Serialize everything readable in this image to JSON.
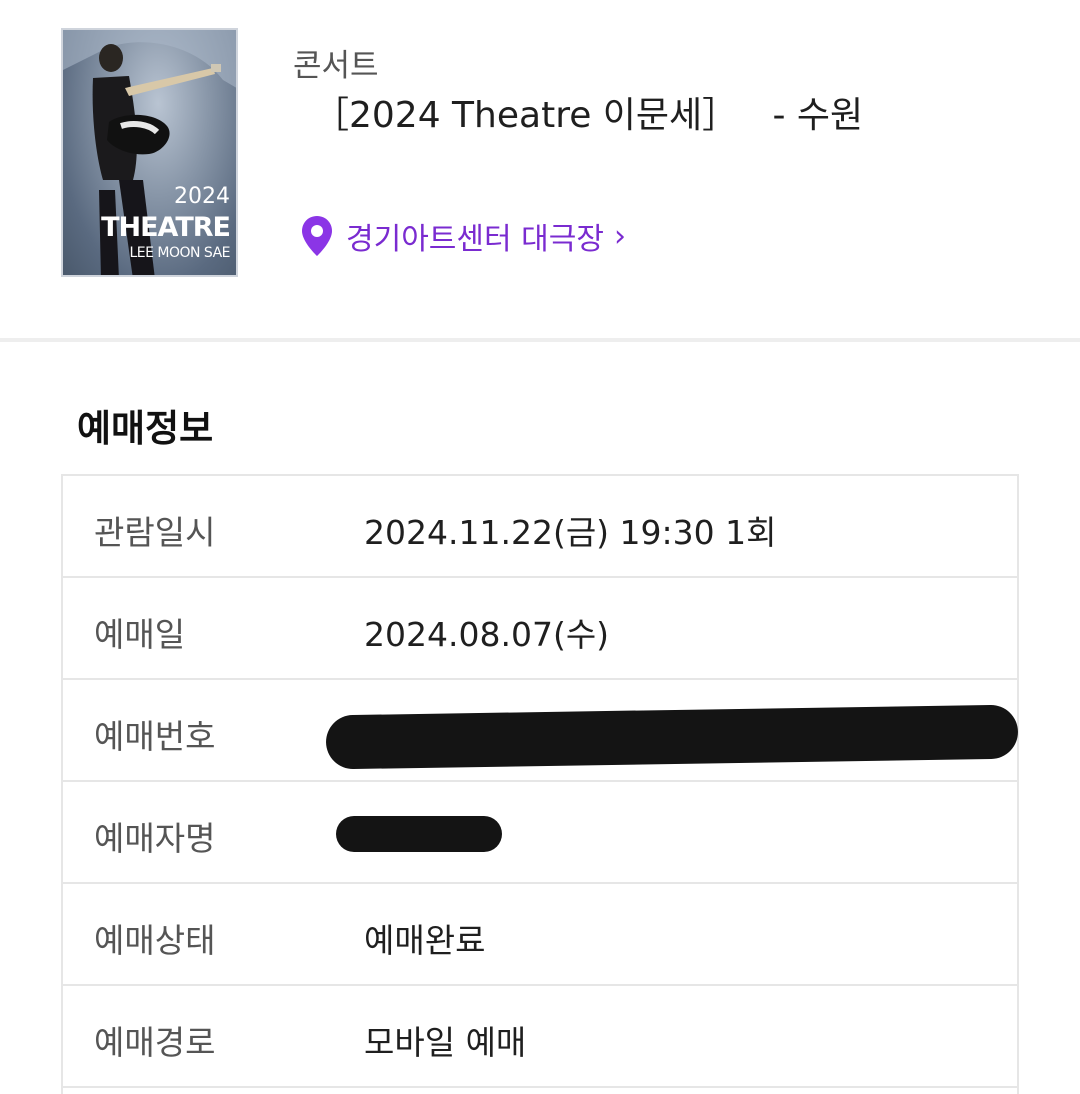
{
  "event": {
    "category": "콘서트",
    "title": "［2024 Theatre 이문세］   - 수원",
    "venue": "경기아트센터 대극장",
    "venue_icon": "location-pin-icon",
    "venue_color": "#7a2bd0"
  },
  "poster": {
    "year": "2024",
    "title": "THEATRE",
    "subtitle": "LEE MOON SAE"
  },
  "booking": {
    "section_title": "예매정보",
    "rows": [
      {
        "label": "관람일시",
        "value": "2024.11.22(금) 19:30 1회"
      },
      {
        "label": "예매일",
        "value": "2024.08.07(수)"
      },
      {
        "label": "예매번호",
        "value": ""
      },
      {
        "label": "예매자명",
        "value": ""
      },
      {
        "label": "예매상태",
        "value": "예매완료"
      },
      {
        "label": "예매경로",
        "value": "모바일 예매"
      }
    ]
  }
}
